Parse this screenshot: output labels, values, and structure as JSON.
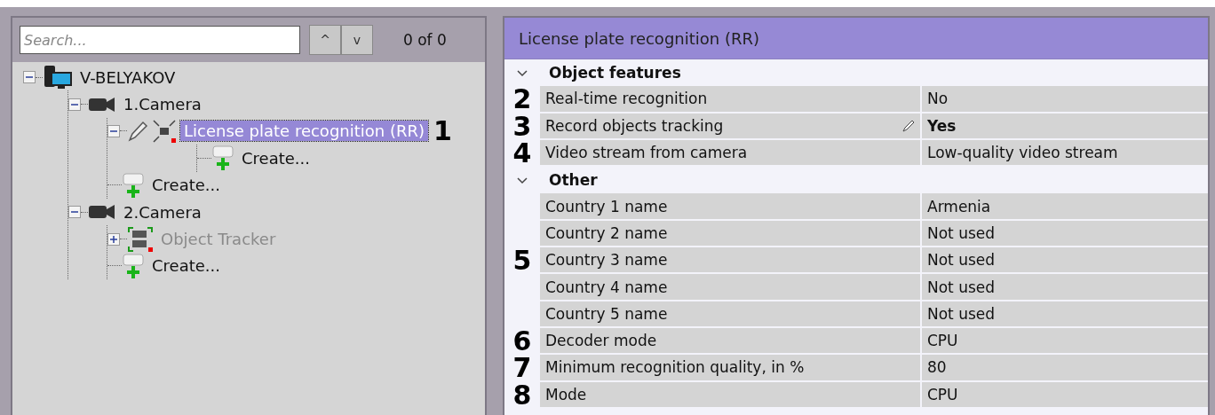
{
  "search": {
    "placeholder": "Search...",
    "counter": "0 of 0",
    "prev_label": "^",
    "next_label": "v"
  },
  "tree": [
    {
      "label": "V-BELYAKOV",
      "kind": "server",
      "expanded": true,
      "selected": false,
      "disabled": false,
      "children": [
        {
          "label": "1.Camera",
          "kind": "camera",
          "expanded": true,
          "selected": false,
          "disabled": false,
          "children": [
            {
              "label": "License plate recognition (RR)",
              "kind": "detector",
              "expanded": true,
              "selected": true,
              "disabled": false,
              "marker": "1",
              "children": [
                {
                  "label": "Create...",
                  "kind": "create",
                  "selected": false,
                  "disabled": false
                }
              ]
            },
            {
              "label": "Create...",
              "kind": "create",
              "selected": false,
              "disabled": false
            }
          ]
        },
        {
          "label": "2.Camera",
          "kind": "camera",
          "expanded": true,
          "selected": false,
          "disabled": false,
          "children": [
            {
              "label": "Object Tracker",
              "kind": "tracker",
              "expanded": false,
              "selected": false,
              "disabled": true
            },
            {
              "label": "Create...",
              "kind": "create",
              "selected": false,
              "disabled": false
            }
          ]
        }
      ]
    }
  ],
  "properties": {
    "title": "License plate recognition (RR)",
    "groups": [
      {
        "name": "Object features",
        "expanded": true,
        "rows": [
          {
            "name": "Real-time recognition",
            "value": "No",
            "marker": "2",
            "modified": false
          },
          {
            "name": "Record objects tracking",
            "value": "Yes",
            "marker": "3",
            "modified": true
          },
          {
            "name": "Video stream from camera",
            "value": "Low-quality video stream",
            "marker": "4",
            "modified": false
          }
        ]
      },
      {
        "name": "Other",
        "expanded": true,
        "rows": [
          {
            "name": "Country 1 name",
            "value": "Armenia",
            "modified": false
          },
          {
            "name": "Country 2 name",
            "value": "Not used",
            "modified": false
          },
          {
            "name": "Country 3 name",
            "value": "Not used",
            "marker": "5",
            "modified": false
          },
          {
            "name": "Country 4 name",
            "value": "Not used",
            "modified": false
          },
          {
            "name": "Country 5 name",
            "value": "Not used",
            "modified": false
          },
          {
            "name": "Decoder mode",
            "value": "CPU",
            "marker": "6",
            "modified": false
          },
          {
            "name": "Minimum recognition quality, in %",
            "value": "80",
            "marker": "7",
            "modified": false
          },
          {
            "name": "Mode",
            "value": "CPU",
            "marker": "8",
            "modified": false
          }
        ]
      }
    ]
  }
}
